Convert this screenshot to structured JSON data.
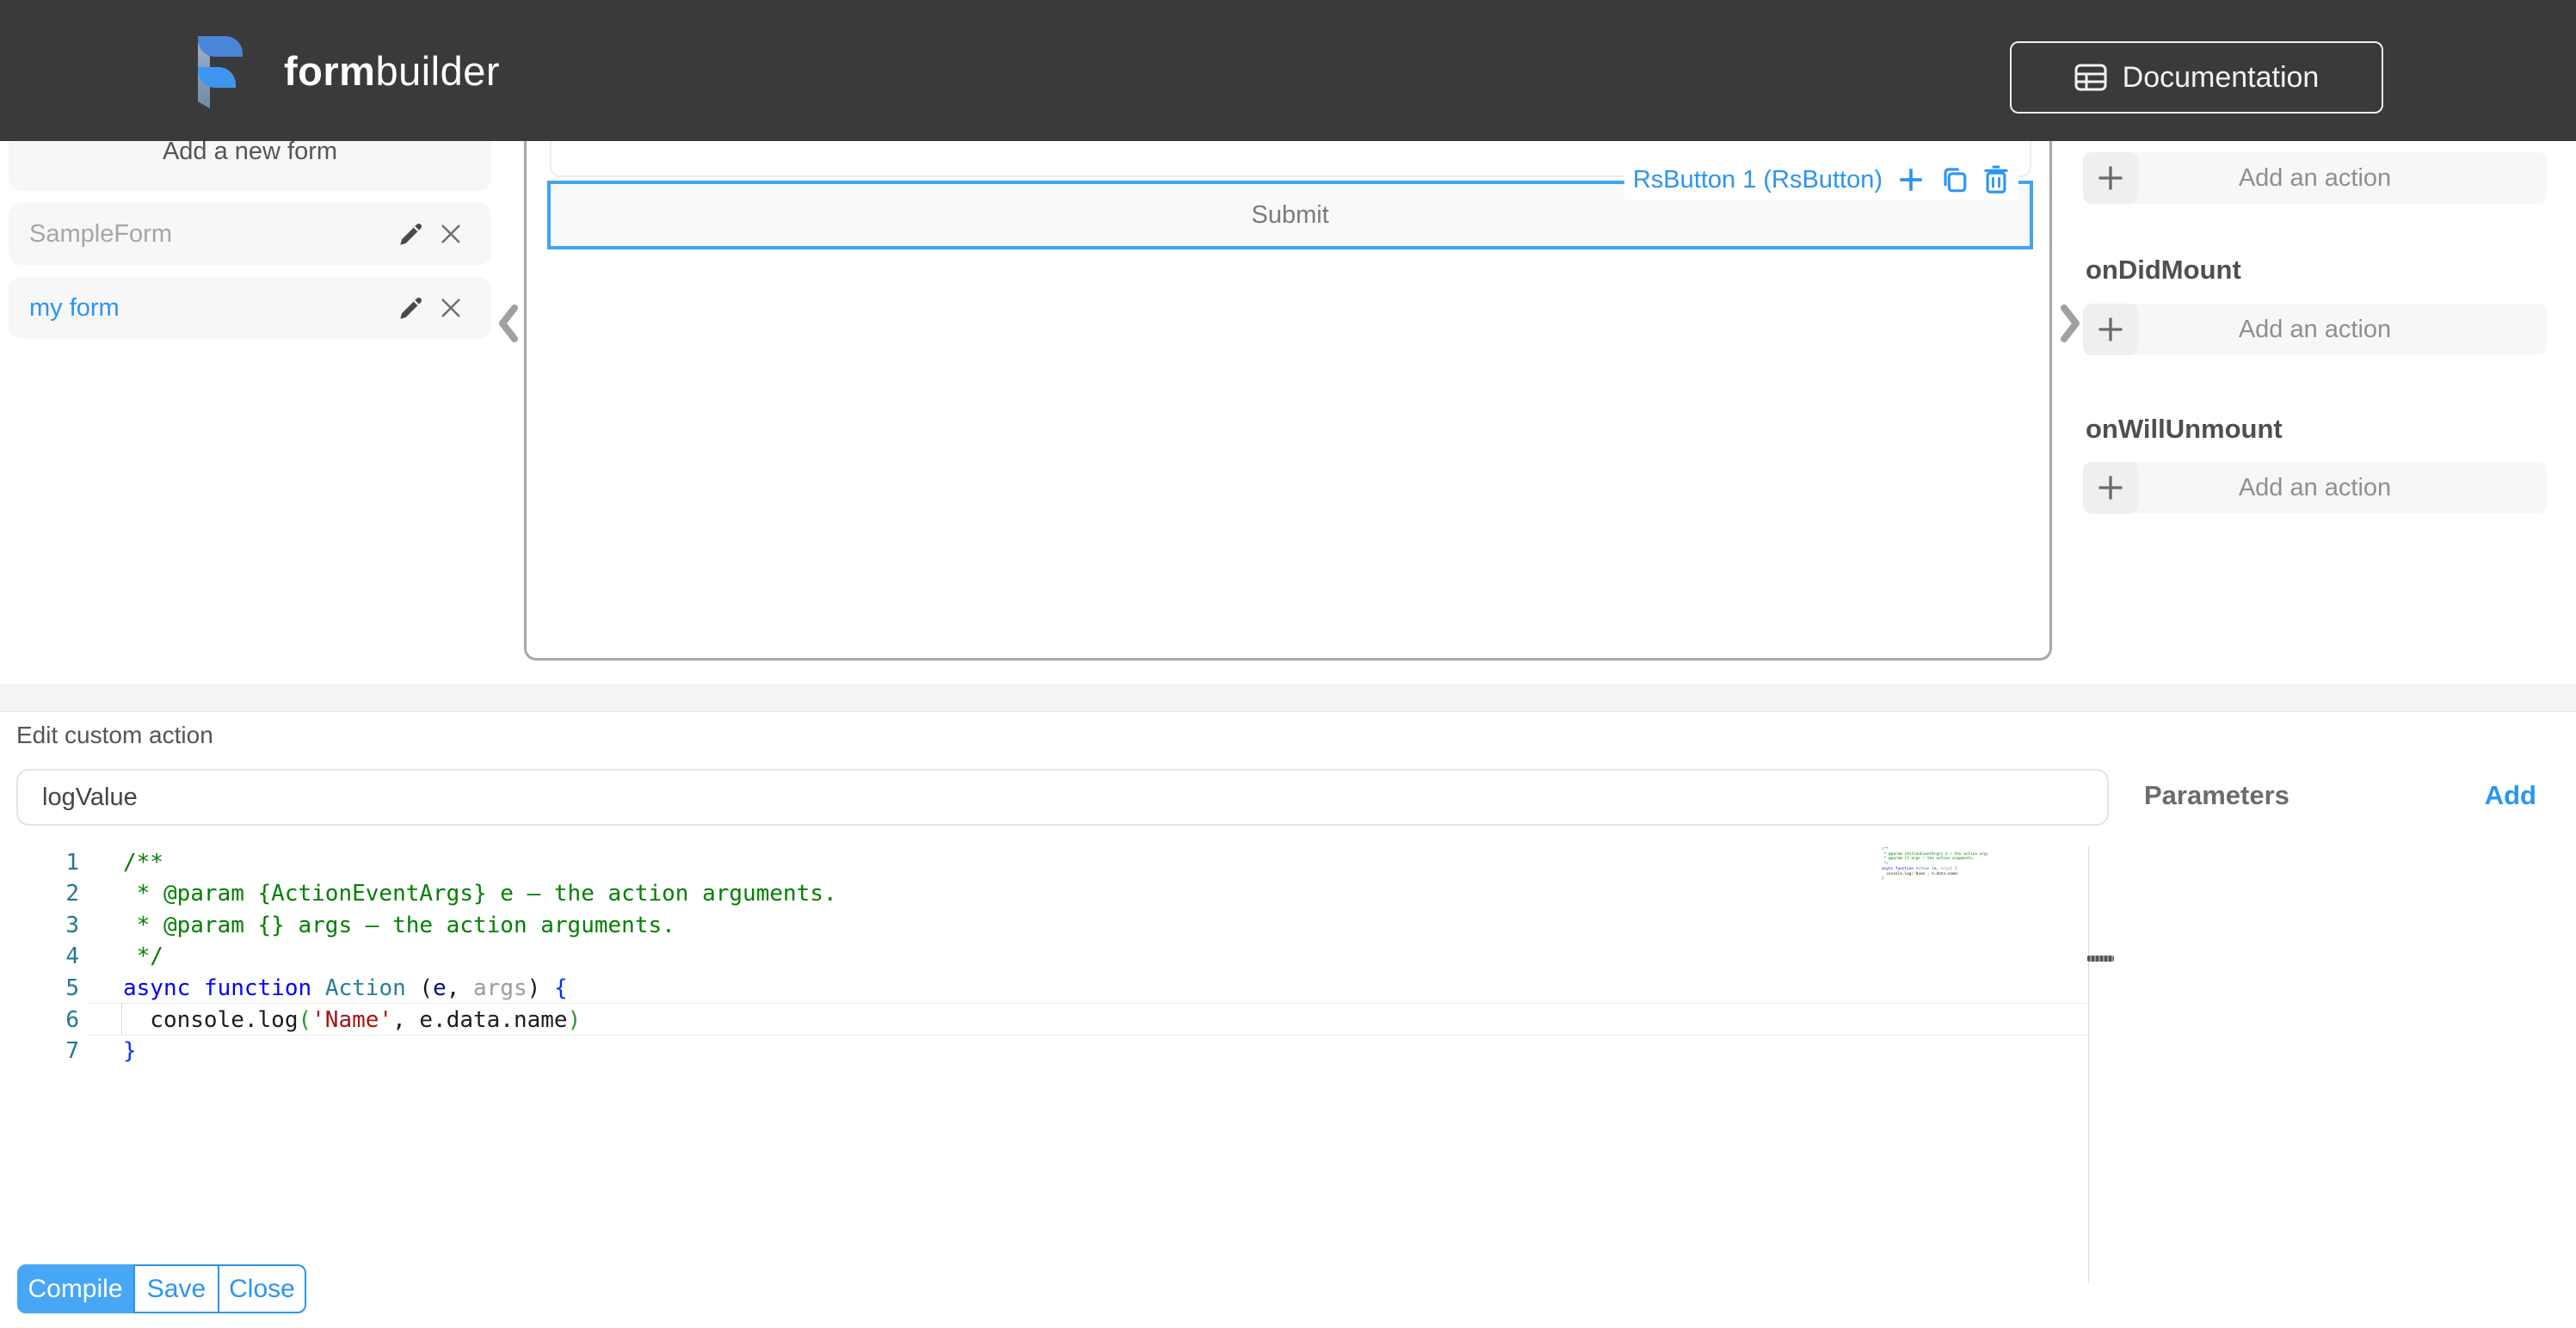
{
  "theme": {
    "header_bg": "#3a3a3a",
    "accent_blue": "#2b95f0",
    "compile_button_blue": "#47a7f6",
    "selection_blue": "#41a4f5",
    "comment_green": "#008000",
    "string_red": "#a31515",
    "line_number_teal": "#237893"
  },
  "header": {
    "brand_bold": "form",
    "brand_light": "builder",
    "documentation_label": "Documentation"
  },
  "sidebar": {
    "add_form_label": "Add a new form",
    "forms": [
      {
        "name": "SampleForm",
        "selected": false
      },
      {
        "name": "my form",
        "selected": true
      }
    ]
  },
  "canvas": {
    "selected_widget_label": "RsButton 1 (RsButton)",
    "button_text": "Submit"
  },
  "right_panel": {
    "groups": [
      {
        "heading": "",
        "action_label": "Add an action"
      },
      {
        "heading": "onDidMount",
        "action_label": "Add an action"
      },
      {
        "heading": "onWillUnmount",
        "action_label": "Add an action"
      }
    ]
  },
  "action_editor": {
    "title": "Edit custom action",
    "name_value": "logValue",
    "parameters_label": "Parameters",
    "add_label": "Add",
    "buttons": {
      "compile": "Compile",
      "save": "Save",
      "close": "Close"
    },
    "code_lines": [
      {
        "n": "1",
        "tokens": [
          {
            "t": "/**",
            "c": "comment"
          }
        ]
      },
      {
        "n": "2",
        "tokens": [
          {
            "t": " * @param {ActionEventArgs} e — the action arguments.",
            "c": "comment"
          }
        ]
      },
      {
        "n": "3",
        "tokens": [
          {
            "t": " * @param {} args — the action arguments.",
            "c": "comment"
          }
        ]
      },
      {
        "n": "4",
        "tokens": [
          {
            "t": " */",
            "c": "comment"
          }
        ]
      },
      {
        "n": "5",
        "tokens": [
          {
            "t": "async",
            "c": "kw"
          },
          {
            "t": " ",
            "c": "plain"
          },
          {
            "t": "function",
            "c": "kw"
          },
          {
            "t": " ",
            "c": "plain"
          },
          {
            "t": "Action",
            "c": "fn"
          },
          {
            "t": " (",
            "c": "plain"
          },
          {
            "t": "e",
            "c": "param"
          },
          {
            "t": ", ",
            "c": "plain"
          },
          {
            "t": "args",
            "c": "muted"
          },
          {
            "t": ") ",
            "c": "plain"
          },
          {
            "t": "{",
            "c": "brace"
          }
        ]
      },
      {
        "n": "6",
        "tokens": [
          {
            "t": "  console.log",
            "c": "plain"
          },
          {
            "t": "(",
            "c": "paren"
          },
          {
            "t": "'Name'",
            "c": "str"
          },
          {
            "t": ", e.data.name",
            "c": "plain"
          },
          {
            "t": ")",
            "c": "paren"
          }
        ]
      },
      {
        "n": "7",
        "tokens": [
          {
            "t": "}",
            "c": "brace"
          }
        ]
      }
    ],
    "current_line_number": "6"
  }
}
